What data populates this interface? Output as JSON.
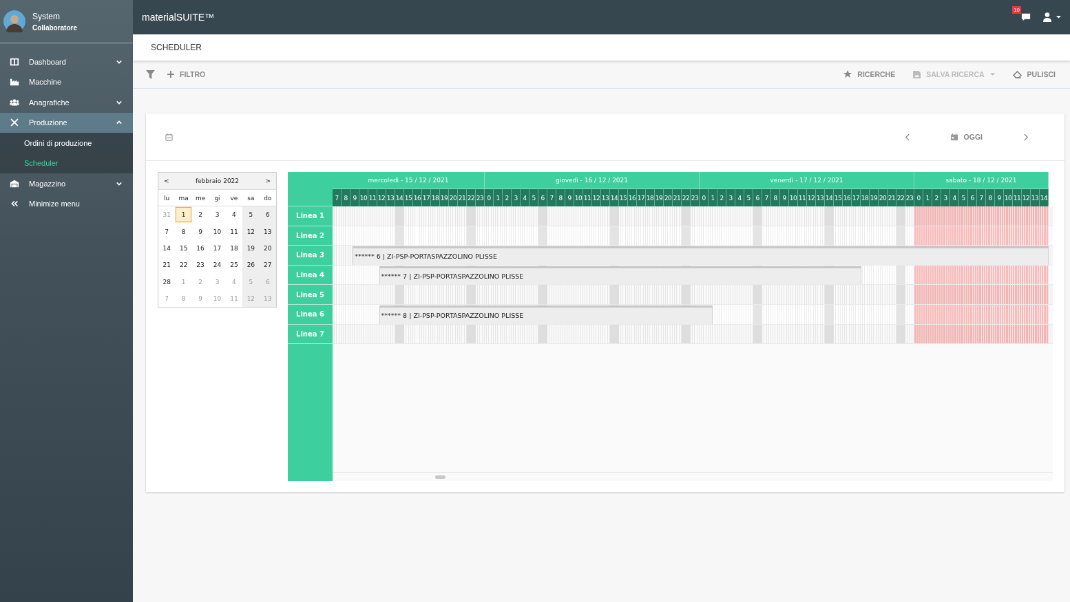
{
  "user": {
    "name": "System",
    "role": "Collaboratore"
  },
  "sidebar": {
    "items": [
      {
        "label": "Dashboard",
        "expanded": false,
        "selected": false
      },
      {
        "label": "Macchine",
        "selected": false
      },
      {
        "label": "Anagrafiche",
        "expanded": false,
        "selected": false
      },
      {
        "label": "Produzione",
        "expanded": true,
        "selected": true,
        "children": [
          {
            "label": "Ordini di produzione",
            "selected": false
          },
          {
            "label": "Scheduler",
            "selected": true
          }
        ]
      },
      {
        "label": "Magazzino",
        "expanded": false,
        "selected": false
      },
      {
        "label": "Minimize menu",
        "selected": false
      }
    ]
  },
  "app_title": "materialSUITE™",
  "notifications": {
    "count": "10"
  },
  "page_title": "SCHEDULER",
  "toolbar": {
    "filter": "FILTRO",
    "searches": "RICERCHE",
    "save_search": {
      "label": "SALVA RICERCA",
      "disabled": true
    },
    "clear": "PULISCI"
  },
  "nav": {
    "today": "OGGI"
  },
  "calendar": {
    "month": "febbraio 2022",
    "prev": "<",
    "next": ">",
    "weekdays": [
      "lu",
      "ma",
      "me",
      "gi",
      "ve",
      "sa",
      "do"
    ],
    "weeks": [
      [
        {
          "label": "31",
          "muted": true,
          "selected": false
        },
        {
          "label": "1",
          "muted": false,
          "selected": true
        },
        {
          "label": "2",
          "muted": false,
          "selected": false
        },
        {
          "label": "3",
          "muted": false,
          "selected": false
        },
        {
          "label": "4",
          "muted": false,
          "selected": false
        },
        {
          "label": "5",
          "muted": false,
          "selected": false
        },
        {
          "label": "6",
          "muted": false,
          "selected": false
        }
      ],
      [
        {
          "label": "7",
          "muted": false,
          "selected": false
        },
        {
          "label": "8",
          "muted": false,
          "selected": false
        },
        {
          "label": "9",
          "muted": false,
          "selected": false
        },
        {
          "label": "10",
          "muted": false,
          "selected": false
        },
        {
          "label": "11",
          "muted": false,
          "selected": false
        },
        {
          "label": "12",
          "muted": false,
          "selected": false
        },
        {
          "label": "13",
          "muted": false,
          "selected": false
        }
      ],
      [
        {
          "label": "14",
          "muted": false,
          "selected": false
        },
        {
          "label": "15",
          "muted": false,
          "selected": false
        },
        {
          "label": "16",
          "muted": false,
          "selected": false
        },
        {
          "label": "17",
          "muted": false,
          "selected": false
        },
        {
          "label": "18",
          "muted": false,
          "selected": false
        },
        {
          "label": "19",
          "muted": false,
          "selected": false
        },
        {
          "label": "20",
          "muted": false,
          "selected": false
        }
      ],
      [
        {
          "label": "21",
          "muted": false,
          "selected": false
        },
        {
          "label": "22",
          "muted": false,
          "selected": false
        },
        {
          "label": "23",
          "muted": false,
          "selected": false
        },
        {
          "label": "24",
          "muted": false,
          "selected": false
        },
        {
          "label": "25",
          "muted": false,
          "selected": false
        },
        {
          "label": "26",
          "muted": false,
          "selected": false
        },
        {
          "label": "27",
          "muted": false,
          "selected": false
        }
      ],
      [
        {
          "label": "28",
          "muted": false,
          "selected": false
        },
        {
          "label": "1",
          "muted": true,
          "selected": false
        },
        {
          "label": "2",
          "muted": true,
          "selected": false
        },
        {
          "label": "3",
          "muted": true,
          "selected": false
        },
        {
          "label": "4",
          "muted": true,
          "selected": false
        },
        {
          "label": "5",
          "muted": true,
          "selected": false
        },
        {
          "label": "6",
          "muted": true,
          "selected": false
        }
      ],
      [
        {
          "label": "7",
          "muted": true,
          "selected": false
        },
        {
          "label": "8",
          "muted": true,
          "selected": false
        },
        {
          "label": "9",
          "muted": true,
          "selected": false
        },
        {
          "label": "10",
          "muted": true,
          "selected": false
        },
        {
          "label": "11",
          "muted": true,
          "selected": false
        },
        {
          "label": "12",
          "muted": true,
          "selected": false
        },
        {
          "label": "13",
          "muted": true,
          "selected": false
        }
      ]
    ]
  },
  "gantt": {
    "days": [
      {
        "label": "mercoledì - 15 / 12 / 2021",
        "holiday": false,
        "hours": [
          {
            "label": "7",
            "shift": false
          },
          {
            "label": "8",
            "shift": false
          },
          {
            "label": "9",
            "shift": false
          },
          {
            "label": "10",
            "shift": false
          },
          {
            "label": "11",
            "shift": false
          },
          {
            "label": "12",
            "shift": false
          },
          {
            "label": "13",
            "shift": false
          },
          {
            "label": "14",
            "shift": true
          },
          {
            "label": "15",
            "shift": false
          },
          {
            "label": "16",
            "shift": false
          },
          {
            "label": "17",
            "shift": false
          },
          {
            "label": "18",
            "shift": false
          },
          {
            "label": "19",
            "shift": false
          },
          {
            "label": "20",
            "shift": false
          },
          {
            "label": "21",
            "shift": false
          },
          {
            "label": "22",
            "shift": true
          },
          {
            "label": "23",
            "shift": false
          }
        ]
      },
      {
        "label": "giovedì - 16 / 12 / 2021",
        "holiday": false,
        "hours": [
          {
            "label": "0",
            "shift": false
          },
          {
            "label": "1",
            "shift": false
          },
          {
            "label": "2",
            "shift": false
          },
          {
            "label": "3",
            "shift": false
          },
          {
            "label": "4",
            "shift": false
          },
          {
            "label": "5",
            "shift": false
          },
          {
            "label": "6",
            "shift": true
          },
          {
            "label": "7",
            "shift": false
          },
          {
            "label": "8",
            "shift": false
          },
          {
            "label": "9",
            "shift": false
          },
          {
            "label": "10",
            "shift": false
          },
          {
            "label": "11",
            "shift": false
          },
          {
            "label": "12",
            "shift": false
          },
          {
            "label": "13",
            "shift": false
          },
          {
            "label": "14",
            "shift": true
          },
          {
            "label": "15",
            "shift": false
          },
          {
            "label": "16",
            "shift": false
          },
          {
            "label": "17",
            "shift": false
          },
          {
            "label": "18",
            "shift": false
          },
          {
            "label": "19",
            "shift": false
          },
          {
            "label": "20",
            "shift": false
          },
          {
            "label": "21",
            "shift": false
          },
          {
            "label": "22",
            "shift": true
          },
          {
            "label": "23",
            "shift": false
          }
        ]
      },
      {
        "label": "venerdì - 17 / 12 / 2021",
        "holiday": false,
        "hours": [
          {
            "label": "0",
            "shift": false
          },
          {
            "label": "1",
            "shift": false
          },
          {
            "label": "2",
            "shift": false
          },
          {
            "label": "3",
            "shift": false
          },
          {
            "label": "4",
            "shift": false
          },
          {
            "label": "5",
            "shift": false
          },
          {
            "label": "6",
            "shift": true
          },
          {
            "label": "7",
            "shift": false
          },
          {
            "label": "8",
            "shift": false
          },
          {
            "label": "9",
            "shift": false
          },
          {
            "label": "10",
            "shift": false
          },
          {
            "label": "11",
            "shift": false
          },
          {
            "label": "12",
            "shift": false
          },
          {
            "label": "13",
            "shift": false
          },
          {
            "label": "14",
            "shift": true
          },
          {
            "label": "15",
            "shift": false
          },
          {
            "label": "16",
            "shift": false
          },
          {
            "label": "17",
            "shift": false
          },
          {
            "label": "18",
            "shift": false
          },
          {
            "label": "19",
            "shift": false
          },
          {
            "label": "20",
            "shift": false
          },
          {
            "label": "21",
            "shift": false
          },
          {
            "label": "22",
            "shift": true
          },
          {
            "label": "23",
            "shift": false
          }
        ]
      },
      {
        "label": "sabato - 18 / 12 / 2021",
        "holiday": true,
        "hours": [
          {
            "label": "0",
            "shift": false
          },
          {
            "label": "1",
            "shift": false
          },
          {
            "label": "2",
            "shift": false
          },
          {
            "label": "3",
            "shift": false
          },
          {
            "label": "4",
            "shift": false
          },
          {
            "label": "5",
            "shift": false
          },
          {
            "label": "6",
            "shift": false
          },
          {
            "label": "7",
            "shift": false
          },
          {
            "label": "8",
            "shift": false
          },
          {
            "label": "9",
            "shift": false
          },
          {
            "label": "10",
            "shift": false
          },
          {
            "label": "11",
            "shift": false
          },
          {
            "label": "12",
            "shift": false
          },
          {
            "label": "13",
            "shift": false
          },
          {
            "label": "14",
            "shift": false
          }
        ]
      }
    ],
    "lines": [
      {
        "label": "Linea 1"
      },
      {
        "label": "Linea 2"
      },
      {
        "label": "Linea 3",
        "bars": [
          {
            "text": "****** 6 | ZI-PSP-PORTASPAZZOLINO PLISSE"
          }
        ]
      },
      {
        "label": "Linea 4",
        "bars": [
          {
            "text": "****** 7 | ZI-PSP-PORTASPAZZOLINO PLISSE"
          }
        ]
      },
      {
        "label": "Linea 5"
      },
      {
        "label": "Linea 6",
        "bars": [
          {
            "text": "****** 8 | ZI-PSP-PORTASPAZZOLINO PLISSE"
          }
        ]
      },
      {
        "label": "Linea 7"
      }
    ]
  }
}
